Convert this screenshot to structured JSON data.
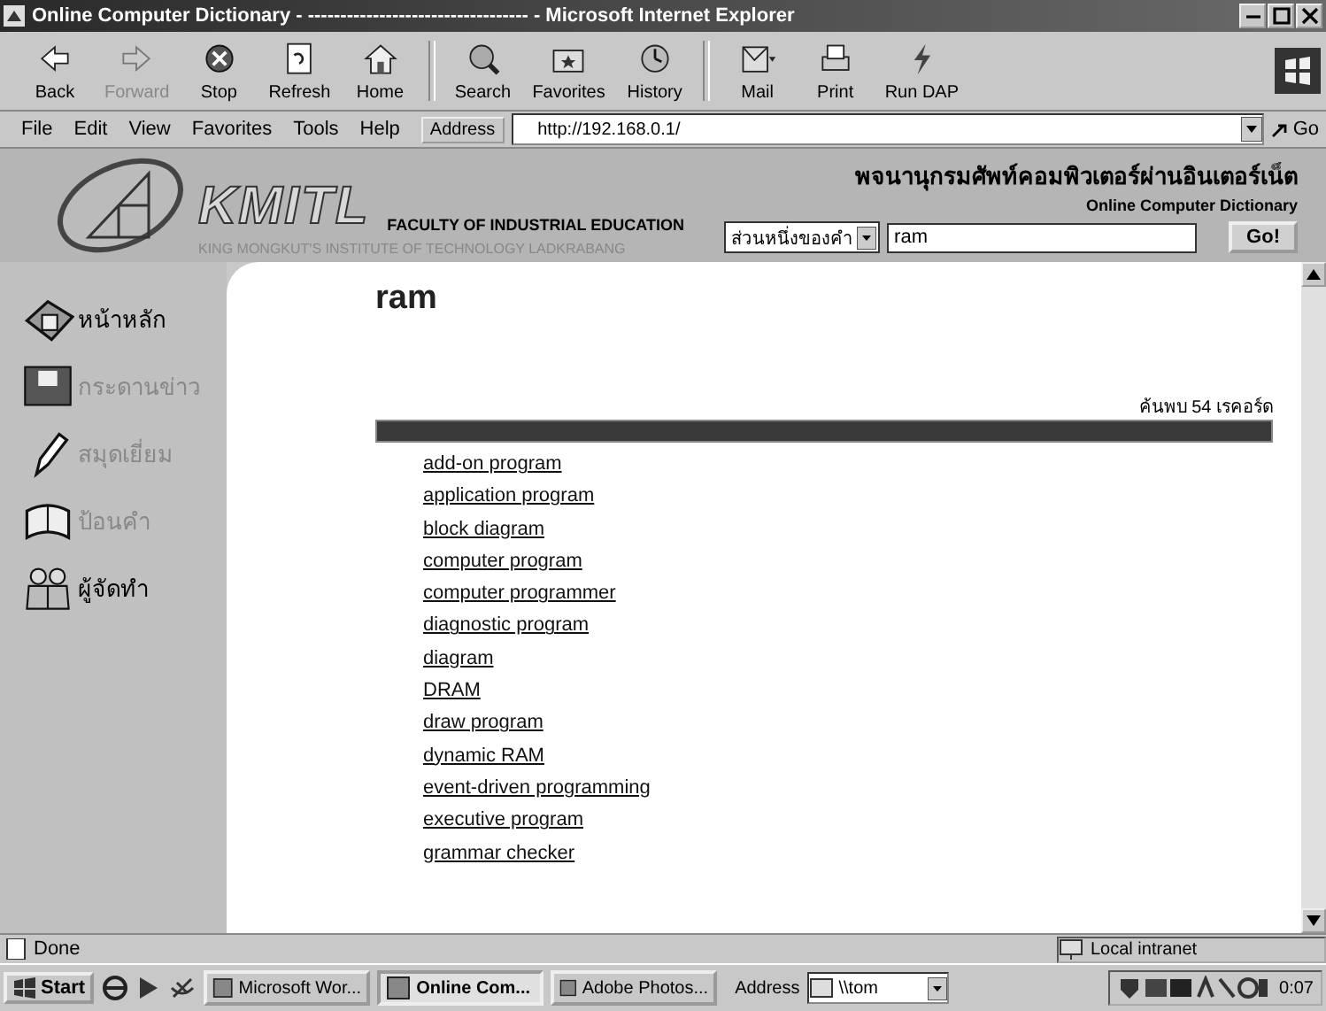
{
  "window": {
    "title": "Online Computer Dictionary - ---------------------------------- - Microsoft Internet Explorer"
  },
  "toolbar": [
    {
      "label": "Back",
      "disabled": false
    },
    {
      "label": "Forward",
      "disabled": true
    },
    {
      "label": "Stop",
      "disabled": false
    },
    {
      "label": "Refresh",
      "disabled": false
    },
    {
      "label": "Home",
      "disabled": false
    },
    {
      "label": "Search",
      "disabled": false
    },
    {
      "label": "Favorites",
      "disabled": false
    },
    {
      "label": "History",
      "disabled": false
    },
    {
      "label": "Mail",
      "disabled": false
    },
    {
      "label": "Print",
      "disabled": false
    },
    {
      "label": "Run DAP",
      "disabled": false
    }
  ],
  "menu": [
    "File",
    "Edit",
    "View",
    "Favorites",
    "Tools",
    "Help"
  ],
  "address": {
    "label": "Address",
    "value": "http://192.168.0.1/",
    "go": "Go"
  },
  "header": {
    "logo": "KMITL",
    "faculty": "FACULTY OF INDUSTRIAL EDUCATION",
    "institute": "KING MONGKUT'S INSTITUTE OF TECHNOLOGY LADKRABANG",
    "thai_title": "พจนานุกรมศัพท์คอมพิวเตอร์ผ่านอินเตอร์เน็ต",
    "english_title": "Online Computer Dictionary",
    "mode": "ส่วนหนึ่งของคำ",
    "query": "ram",
    "button": "Go!"
  },
  "sidebar": {
    "items": [
      {
        "label": "หน้าหลัก",
        "faded": false
      },
      {
        "label": "กระดานข่าว",
        "faded": true
      },
      {
        "label": "สมุดเยี่ยม",
        "faded": true
      },
      {
        "label": "ป้อนคำ",
        "faded": true
      },
      {
        "label": "ผู้จัดทำ",
        "faded": false
      }
    ]
  },
  "content": {
    "heading": "ram",
    "count": "ค้นพบ 54 เรคอร์ด",
    "results": [
      "add-on program",
      "application program",
      "block diagram",
      "computer program",
      "computer programmer",
      "diagnostic program",
      "diagram",
      "DRAM",
      "draw program",
      "dynamic RAM",
      "event-driven programming",
      "executive program",
      "grammar checker"
    ]
  },
  "status_bar": {
    "text": "Done",
    "zone": "Local intranet"
  },
  "taskbar": {
    "start": "Start",
    "tasks": [
      {
        "label": "Microsoft Wor...",
        "selected": false
      },
      {
        "label": "Online Com...",
        "selected": true
      },
      {
        "label": "Adobe Photos...",
        "selected": false
      }
    ],
    "address_label": "Address",
    "address_value": "\\\\tom",
    "clock": "0:07"
  }
}
